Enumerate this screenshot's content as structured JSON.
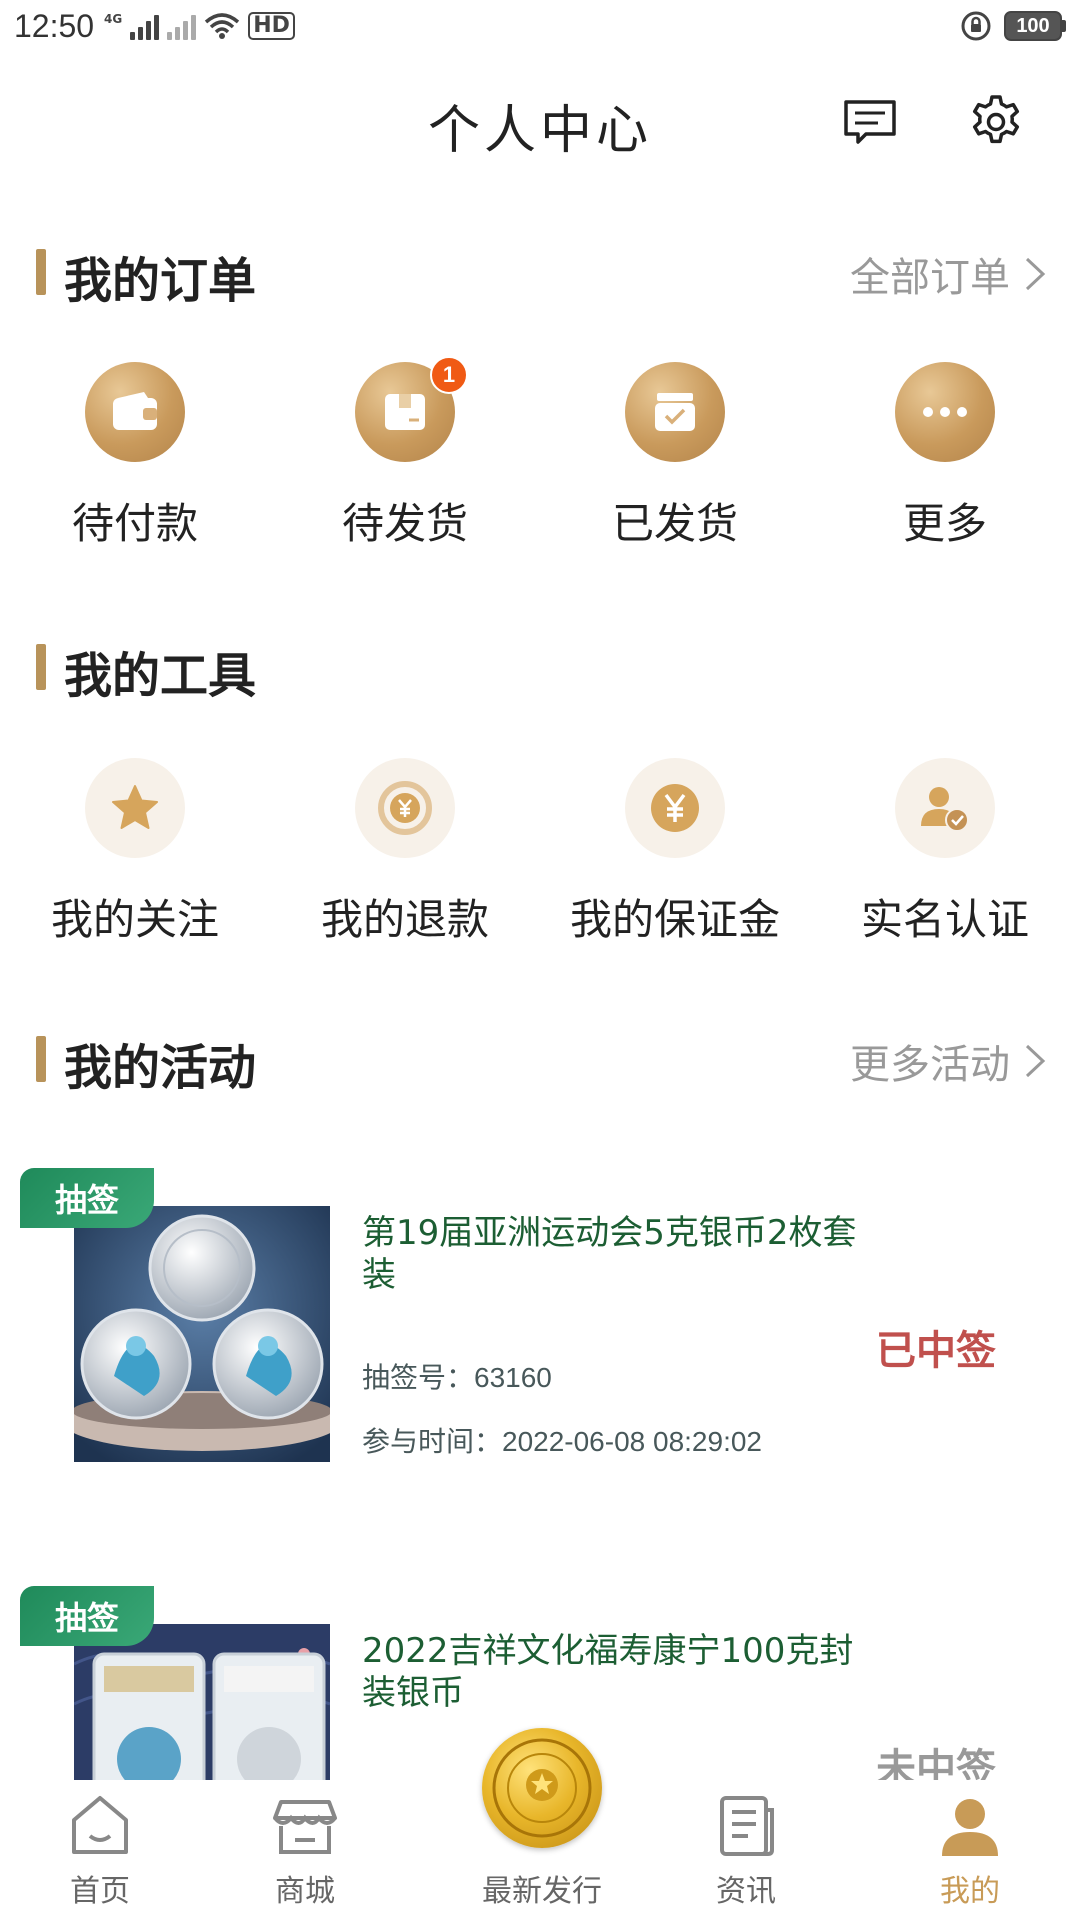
{
  "status_bar": {
    "time": "12:50",
    "network": "4G",
    "hd": "HD",
    "battery": "100"
  },
  "header": {
    "title": "个人中心",
    "message_icon": "message-icon",
    "settings_icon": "gear-icon"
  },
  "orders": {
    "title": "我的订单",
    "all_link": "全部订单",
    "items": [
      {
        "label": "待付款",
        "icon": "wallet-icon"
      },
      {
        "label": "待发货",
        "icon": "package-icon",
        "badge": "1"
      },
      {
        "label": "已发货",
        "icon": "box-check-icon"
      },
      {
        "label": "更多",
        "icon": "more-icon"
      }
    ]
  },
  "tools": {
    "title": "我的工具",
    "items": [
      {
        "label": "我的关注",
        "icon": "star-icon"
      },
      {
        "label": "我的退款",
        "icon": "refund-icon"
      },
      {
        "label": "我的保证金",
        "icon": "yen-icon"
      },
      {
        "label": "实名认证",
        "icon": "verified-user-icon"
      }
    ]
  },
  "activities": {
    "title": "我的活动",
    "more_link": "更多活动",
    "cards": [
      {
        "tag": "抽签",
        "title": "第19届亚洲运动会5克银币2枚套装",
        "status": "已中签",
        "lottery_no": "抽签号：63160",
        "join_time": "参与时间：2022-06-08 08:29:02"
      },
      {
        "tag": "抽签",
        "title": "2022吉祥文化福寿康宁100克封装银币",
        "status": "未中签"
      }
    ]
  },
  "colors": {
    "accent_gold": "#c89b57",
    "green_title": "#1c5e33",
    "win_red": "#c0504d",
    "lose_gray": "#999999"
  },
  "nav": {
    "items": [
      {
        "label": "首页",
        "icon": "home-icon"
      },
      {
        "label": "商城",
        "icon": "store-icon"
      },
      {
        "label": "最新发行",
        "icon": "coin-icon"
      },
      {
        "label": "资讯",
        "icon": "news-icon"
      },
      {
        "label": "我的",
        "icon": "user-icon",
        "active": true
      }
    ]
  }
}
